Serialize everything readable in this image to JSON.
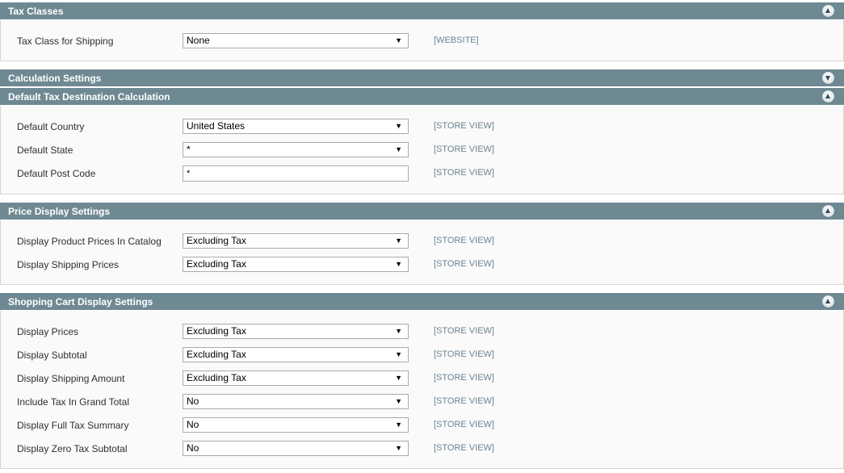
{
  "sections": [
    {
      "title": "Tax Classes",
      "toggle": "collapse-up",
      "rows": [
        {
          "label": "Tax Class for Shipping",
          "type": "select",
          "value": "None",
          "scope": "[WEBSITE]"
        }
      ]
    },
    {
      "title": "Calculation Settings",
      "toggle": "expand-down",
      "rows": []
    },
    {
      "title": "Default Tax Destination Calculation",
      "toggle": "collapse-up",
      "rows": [
        {
          "label": "Default Country",
          "type": "select",
          "value": "United States",
          "scope": "[STORE VIEW]"
        },
        {
          "label": "Default State",
          "type": "select",
          "value": "*",
          "scope": "[STORE VIEW]"
        },
        {
          "label": "Default Post Code",
          "type": "text",
          "value": "*",
          "scope": "[STORE VIEW]"
        }
      ]
    },
    {
      "title": "Price Display Settings",
      "toggle": "collapse-up",
      "rows": [
        {
          "label": "Display Product Prices In Catalog",
          "type": "select",
          "value": "Excluding Tax",
          "scope": "[STORE VIEW]"
        },
        {
          "label": "Display Shipping Prices",
          "type": "select",
          "value": "Excluding Tax",
          "scope": "[STORE VIEW]"
        }
      ]
    },
    {
      "title": "Shopping Cart Display Settings",
      "toggle": "collapse-up",
      "rows": [
        {
          "label": "Display Prices",
          "type": "select",
          "value": "Excluding Tax",
          "scope": "[STORE VIEW]"
        },
        {
          "label": "Display Subtotal",
          "type": "select",
          "value": "Excluding Tax",
          "scope": "[STORE VIEW]"
        },
        {
          "label": "Display Shipping Amount",
          "type": "select",
          "value": "Excluding Tax",
          "scope": "[STORE VIEW]"
        },
        {
          "label": "Include Tax In Grand Total",
          "type": "select",
          "value": "No",
          "scope": "[STORE VIEW]"
        },
        {
          "label": "Display Full Tax Summary",
          "type": "select",
          "value": "No",
          "scope": "[STORE VIEW]"
        },
        {
          "label": "Display Zero Tax Subtotal",
          "type": "select",
          "value": "No",
          "scope": "[STORE VIEW]"
        }
      ]
    }
  ],
  "icons": {
    "dropdown_arrow": "▼"
  },
  "colors": {
    "header_bg": "#6f8992",
    "scope_text": "#6d8391",
    "body_bg": "#fafafa"
  }
}
